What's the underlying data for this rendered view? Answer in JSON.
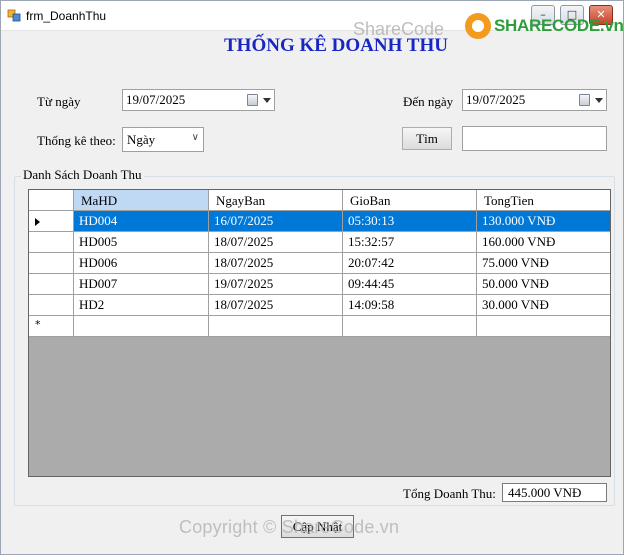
{
  "window": {
    "title": "frm_DoanhThu",
    "controls": {
      "minimize": "–",
      "maximize": "□",
      "close": "✕"
    }
  },
  "watermark": {
    "top": "ShareCode",
    "logo_text": "SHARECODE.vn",
    "bottom": "Copyright © ShareCode.vn"
  },
  "form": {
    "heading": "THỐNG KÊ DOANH THU",
    "from_label": "Từ ngày",
    "from_value": "19/07/2025",
    "to_label": "Đến ngày",
    "to_value": "19/07/2025",
    "group_by_label": "Thống kê theo:",
    "group_by_value": "Ngày",
    "search_button": "Tìm",
    "search_value": ""
  },
  "list": {
    "title": "Danh Sách Doanh Thu",
    "columns": [
      "MaHD",
      "NgayBan",
      "GioBan",
      "TongTien"
    ],
    "rows": [
      [
        "HD004",
        "16/07/2025",
        "05:30:13",
        "130.000 VNĐ"
      ],
      [
        "HD005",
        "18/07/2025",
        "15:32:57",
        "160.000 VNĐ"
      ],
      [
        "HD006",
        "18/07/2025",
        "20:07:42",
        "75.000 VNĐ"
      ],
      [
        "HD007",
        "19/07/2025",
        "09:44:45",
        "50.000 VNĐ"
      ],
      [
        "HD2",
        "18/07/2025",
        "14:09:58",
        "30.000 VNĐ"
      ]
    ],
    "selected_row": 0,
    "new_row_marker": "*"
  },
  "summary": {
    "total_label": "Tổng Doanh Thu:",
    "total_value": "445.000 VNĐ"
  },
  "footer": {
    "update_button": "Cập Nhật"
  },
  "colors": {
    "heading": "#1826c2",
    "selection": "#0078d7",
    "grid_background": "#ababab"
  }
}
